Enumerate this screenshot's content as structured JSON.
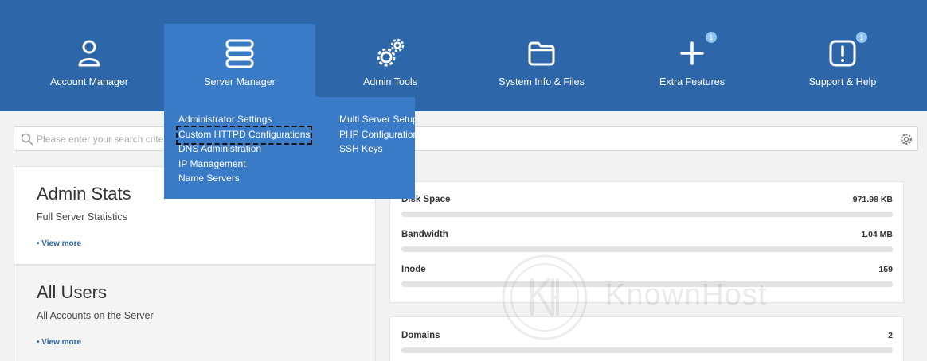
{
  "nav": {
    "items": [
      {
        "label": "Account Manager",
        "icon": "user-icon"
      },
      {
        "label": "Server Manager",
        "icon": "server-icon"
      },
      {
        "label": "Admin Tools",
        "icon": "gears-icon"
      },
      {
        "label": "System Info & Files",
        "icon": "folder-icon"
      },
      {
        "label": "Extra Features",
        "icon": "plus-icon",
        "badge": "1"
      },
      {
        "label": "Support & Help",
        "icon": "alert-icon",
        "badge": "1"
      }
    ],
    "active": "Server Manager"
  },
  "dropdown": {
    "col1": [
      "Administrator Settings",
      "Custom HTTPD Configurations",
      "DNS Administration",
      "IP Management",
      "Name Servers"
    ],
    "col2": [
      "Multi Server Setup",
      "PHP Configuration",
      "SSH Keys"
    ],
    "focused": "Custom HTTPD Configurations"
  },
  "search": {
    "placeholder": "Please enter your search criteria"
  },
  "cards": [
    {
      "title": "Admin Stats",
      "subtitle": "Full Server Statistics",
      "more": "• View more"
    },
    {
      "title": "All Users",
      "subtitle": "All Accounts on the Server",
      "more": "• View more"
    }
  ],
  "stats": [
    {
      "name": "Disk Space",
      "value": "971.98 KB"
    },
    {
      "name": "Bandwidth",
      "value": "1.04 MB"
    },
    {
      "name": "Inode",
      "value": "159"
    }
  ],
  "stats2": [
    {
      "name": "Domains",
      "value": "2"
    }
  ],
  "watermark": {
    "text": "KnownHost"
  },
  "colors": {
    "primary": "#2d66a9",
    "active": "#3a7bc8",
    "badge": "#8fc3f0"
  }
}
